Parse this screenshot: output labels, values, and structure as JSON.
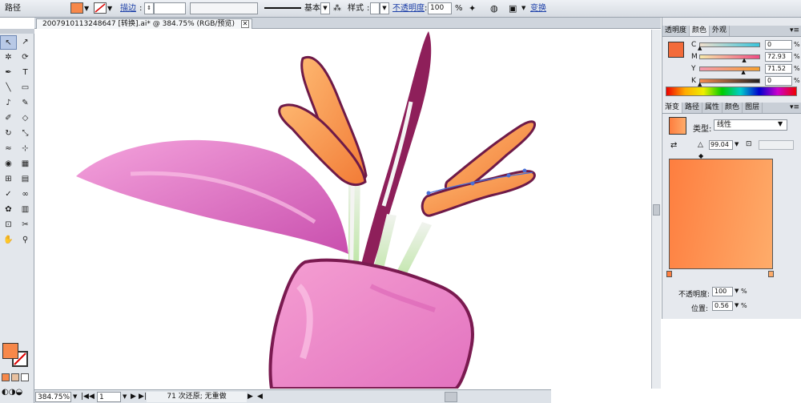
{
  "control_bar": {
    "path_label": "路径",
    "fill_color": "#f7884a",
    "stroke_label": "描边",
    "stroke_profile_label": "基本",
    "style_label": "样式",
    "opacity_label": "不透明度",
    "opacity_value": "100",
    "opacity_unit": "%",
    "transform_label": "变换"
  },
  "document": {
    "tab_title": "20079101132486​47 [转换].ai* @ 384.75% (RGB/预览)",
    "close_glyph": "✕"
  },
  "toolbox": {
    "fill_color": "#f7884a",
    "tools": [
      "selection-tool",
      "direct-selection-tool",
      "magic-wand-tool",
      "lasso-tool",
      "pen-tool",
      "type-tool",
      "line-tool",
      "rectangle-tool",
      "paintbrush-tool",
      "pencil-tool",
      "blob-brush-tool",
      "eraser-tool",
      "rotate-tool",
      "scale-tool",
      "warp-tool",
      "free-transform-tool",
      "shape-builder-tool",
      "perspective-grid-tool",
      "mesh-tool",
      "gradient-tool",
      "eyedropper-tool",
      "blend-tool",
      "symbol-sprayer-tool",
      "column-graph-tool",
      "artboard-tool",
      "slice-tool",
      "hand-tool",
      "zoom-tool"
    ]
  },
  "status_bar": {
    "zoom": "384.75%",
    "artboard": "1",
    "message": "71 次还原; 无重做"
  },
  "color_panel": {
    "tabs": [
      "透明度",
      "颜色",
      "外观"
    ],
    "active_tab": "颜色",
    "swatch": "#f36b3a",
    "channels": [
      {
        "key": "C",
        "value": "0",
        "level": 0,
        "gradient": "linear-gradient(90deg,#f0dfcd,#38c5dc)"
      },
      {
        "key": "M",
        "value": "72.93",
        "level": 72.93,
        "gradient": "linear-gradient(90deg,#f7e9a8,#ef4b83)"
      },
      {
        "key": "Y",
        "value": "71.52",
        "level": 71.52,
        "gradient": "linear-gradient(90deg,#f39ab0,#f6a02e)"
      },
      {
        "key": "K",
        "value": "0",
        "level": 0,
        "gradient": "linear-gradient(90deg,#f68a4e,#222)"
      }
    ],
    "pct": "%"
  },
  "gradient_panel": {
    "tabs": [
      "渐变",
      "路径",
      "属性",
      "颜色",
      "图层"
    ],
    "active_tab": "渐变",
    "type_label": "类型:",
    "type_value": "线性",
    "angle_value": "99.04",
    "ramp_start": "#fe7e3f",
    "ramp_end": "#feac6a",
    "opacity_label": "不透明度:",
    "opacity_value": "100",
    "position_label": "位置:",
    "position_value": "0.56",
    "pct": "%"
  }
}
